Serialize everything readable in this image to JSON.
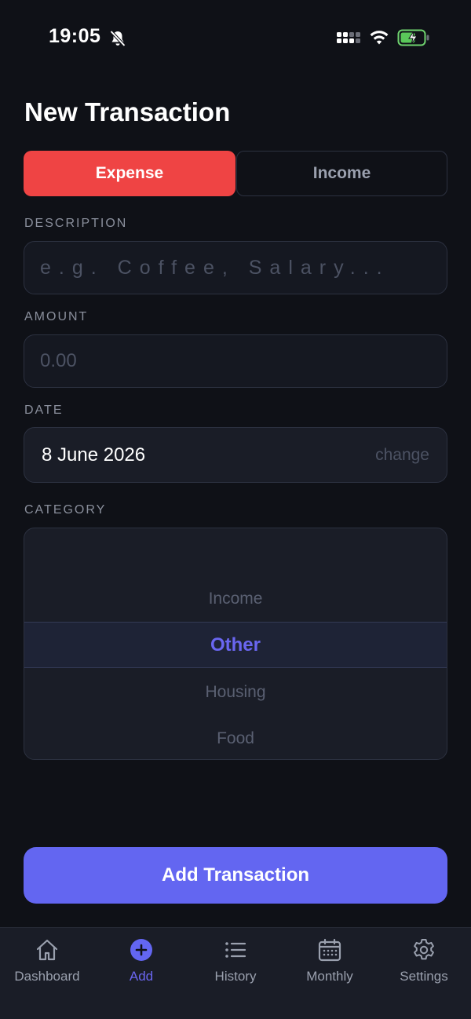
{
  "status_bar": {
    "time": "19:05"
  },
  "page": {
    "title": "New Transaction"
  },
  "type_toggle": {
    "expense_label": "Expense",
    "income_label": "Income",
    "selected": "Expense"
  },
  "description": {
    "label": "DESCRIPTION",
    "value": "",
    "placeholder": "e.g. Coffee, Salary..."
  },
  "amount": {
    "label": "AMOUNT",
    "value": "",
    "placeholder": "0.00"
  },
  "date": {
    "label": "DATE",
    "value": "8 June 2026",
    "change_label": "change"
  },
  "category": {
    "label": "CATEGORY",
    "items": [
      "Income",
      "Other",
      "Housing",
      "Food"
    ],
    "selected": "Other"
  },
  "actions": {
    "add_label": "Add Transaction"
  },
  "tab_bar": {
    "tabs": [
      {
        "label": "Dashboard",
        "icon": "home-icon"
      },
      {
        "label": "Add",
        "icon": "plus-circle-icon"
      },
      {
        "label": "History",
        "icon": "list-icon"
      },
      {
        "label": "Monthly",
        "icon": "calendar-icon"
      },
      {
        "label": "Settings",
        "icon": "gear-icon"
      }
    ],
    "active": "Add"
  },
  "colors": {
    "background": "#0f1117",
    "expense": "#ef4444",
    "accent": "#6366f1",
    "accent_text": "#6a66f0"
  }
}
